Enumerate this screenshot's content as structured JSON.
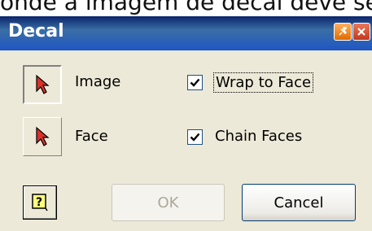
{
  "background_text": "onde a imagem de decal deve se",
  "window": {
    "title": "Decal"
  },
  "picks": {
    "image_label": "Image",
    "face_label": "Face"
  },
  "options": {
    "wrap_to_face": {
      "label": "Wrap to Face",
      "checked": true
    },
    "chain_faces": {
      "label": "Chain Faces",
      "checked": true
    }
  },
  "buttons": {
    "ok": "OK",
    "cancel": "Cancel",
    "help_icon": "help-icon"
  },
  "colors": {
    "titlebar": "#0a246a",
    "face": "#ece9d8",
    "disabled_text": "#aca899",
    "pick_arrow": "#d9322a"
  }
}
